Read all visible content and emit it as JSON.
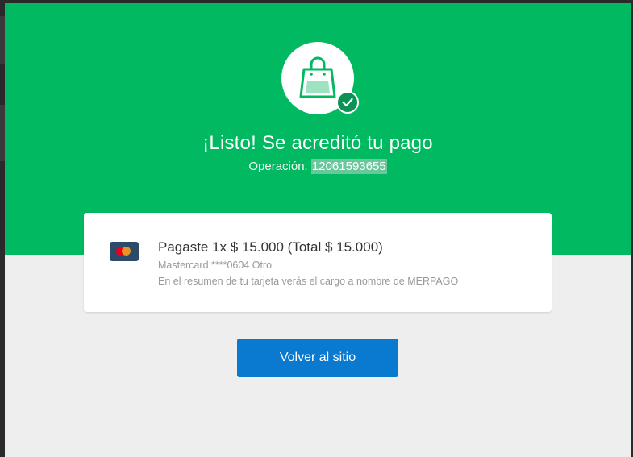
{
  "hero": {
    "title": "¡Listo! Se acreditó tu pago",
    "operation_label": "Operación: ",
    "operation_number": "12061593655",
    "icon": "shopping-bag-icon",
    "badge_icon": "check-icon"
  },
  "payment": {
    "summary": "Pagaste 1x $ 15.000 (Total $ 15.000)",
    "card_detail": "Mastercard ****0604 Otro",
    "statement_note": "En el resumen de tu tarjeta verás el cargo a nombre de MERPAGO",
    "card_icon": "mastercard-icon"
  },
  "actions": {
    "back_label": "Volver al sitio"
  },
  "colors": {
    "hero_green": "#00b960",
    "button_blue": "#0a79d0",
    "page_bg": "#eeeeee"
  }
}
